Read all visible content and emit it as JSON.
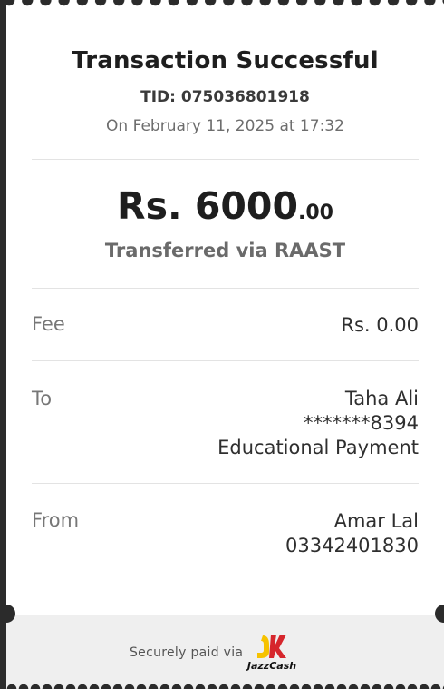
{
  "receipt": {
    "title": "Transaction Successful",
    "tid": "TID: 075036801918",
    "date": "On February 11, 2025 at 17:32",
    "amount_main": "Rs. 6000",
    "amount_decimal": ".00",
    "transfer_method": "Transferred via RAAST",
    "fee": {
      "label": "Fee",
      "value": "Rs. 0.00"
    },
    "to": {
      "label": "To",
      "name": "Taha Ali",
      "account": "*******8394",
      "purpose": "Educational Payment"
    },
    "from": {
      "label": "From",
      "name": "Amar Lal",
      "account": "03342401830"
    }
  },
  "footer": {
    "secure_text": "Securely paid via",
    "brand_name": "JazzCash",
    "brand_icon": "jazzcash-logo-icon",
    "brand_colors": {
      "yellow": "#f6c200",
      "red": "#d6262c"
    }
  },
  "colors": {
    "background": "#2b2b2b",
    "receipt": "#ffffff",
    "footer": "#efefef"
  }
}
